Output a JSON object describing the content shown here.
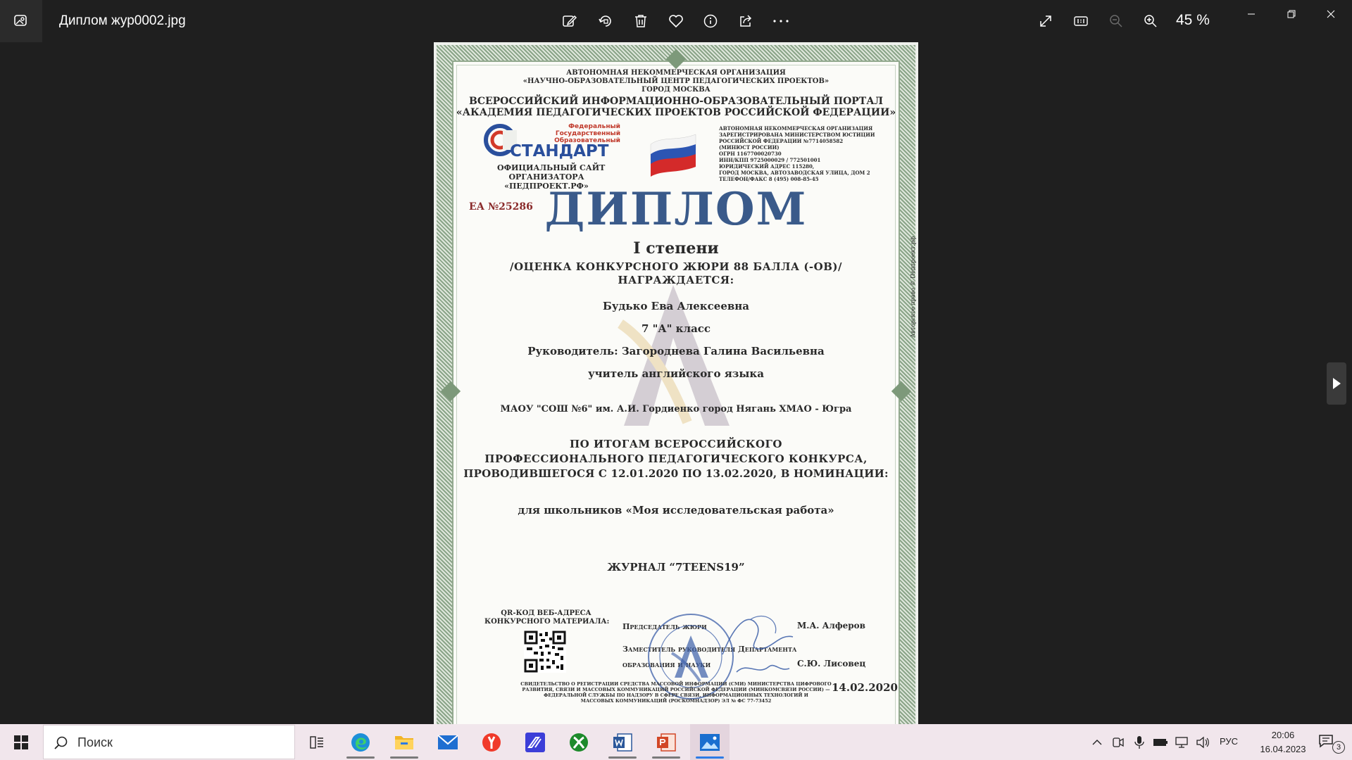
{
  "window": {
    "file_title": "Диплом жур0002.jpg",
    "zoom_label": "45 %"
  },
  "toolbar": {
    "icons": [
      "edit-icon",
      "rotate-icon",
      "delete-icon",
      "favorite-icon",
      "info-icon",
      "share-icon",
      "more-icon"
    ],
    "right_icons": [
      "fullscreen-icon",
      "actual-size-icon",
      "zoom-out-icon",
      "zoom-in-icon"
    ]
  },
  "diploma": {
    "org_line1": "АВТОНОМНАЯ НЕКОММЕРЧЕСКАЯ ОРГАНИЗАЦИЯ",
    "org_line2": "«НАУЧНО-ОБРАЗОВАТЕЛЬНЫЙ ЦЕНТР ПЕДАГОГИЧЕСКИХ ПРОЕКТОВ»",
    "org_line3": "ГОРОД МОСКВА",
    "portal_line1": "ВСЕРОССИЙСКИЙ ИНФОРМАЦИОННО-ОБРАЗОВАТЕЛЬНЫЙ ПОРТАЛ",
    "portal_line2": "«АКАДЕМИЯ ПЕДАГОГИЧЕСКИХ ПРОЕКТОВ РОССИЙСКОЙ ФЕДЕРАЦИИ»",
    "logo_word": "СТАНДАРТ",
    "logo_sub1": "Федеральный",
    "logo_sub2": "Государственный",
    "logo_sub3": "Образовательный",
    "site_line1": "ОФИЦИАЛЬНЫЙ САЙТ",
    "site_line2": "ОРГАНИЗАТОРА",
    "site_line3": "«ПЕДПРОЕКТ.РФ»",
    "reg_lines": [
      "АВТОНОМНАЯ НЕКОММЕРЧЕСКАЯ ОРГАНИЗАЦИЯ",
      "ЗАРЕГИСТРИРОВАНА МИНИСТЕРСТВОМ ЮСТИЦИИ",
      "РОССИЙСКОЙ ФЕДЕРАЦИИ №7714058582",
      "(МИНЮСТ РОССИИ)",
      "ОГРН 1167700020730",
      "ИНН/КПП 9725000029 / 772501001",
      "ЮРИДИЧЕСКИЙ АДРЕС 115280,",
      "ГОРОД МОСКВА, АВТОЗАВОДСКАЯ УЛИЦА, ДОМ 2",
      "ТЕЛЕФОН/ФАКС 8 (495) 008-85-45"
    ],
    "ea_number": "ЕА №25286",
    "title": "ДИПЛОМ",
    "degree": "I степени",
    "score_line": "/ОЦЕНКА КОНКУРСНОГО ЖЮРИ   88    БАЛЛА (-ОВ)/",
    "awarded": "НАГРАЖДАЕТСЯ:",
    "name": "Будько Ева Алексеевна",
    "class": "7 \"А\" класс",
    "supervisor": "Руководитель: Загороднева Галина Васильевна",
    "supervisor_role": "учитель английского языка",
    "school": "МАОУ \"СОШ №6\" им. А.И. Гордиенко город Нягань ХМАО - Югра",
    "result_line1": "ПО ИТОГАМ ВСЕРОССИЙСКОГО",
    "result_line2": "ПРОФЕССИОНАЛЬНОГО ПЕДАГОГИЧЕСКОГО КОНКУРСА,",
    "result_line3": "ПРОВОДИВШЕГОСЯ С 12.01.2020 ПО 13.02.2020, В НОМИНАЦИИ:",
    "nomination": "для школьников «Моя исследовательская работа»",
    "journal": "ЖУРНАЛ “7TEENS19”",
    "qr_line1": "QR-КОД ВЕБ-АДРЕСА",
    "qr_line2": "КОНКУРСНОГО МАТЕРИАЛА:",
    "chair_role": "Председатель жюри",
    "chair_name": "М.А. Алферов",
    "deputy_role1": "Заместитель руководителя Департамента",
    "deputy_role2": "образования и науки",
    "deputy_name": "С.Ю. Лисовец",
    "cert_line1": "СВИДЕТЕЛЬСТВО О РЕГИСТРАЦИИ СРЕДСТВА МАССОВОЙ ИНФОРМАЦИИ (СМИ) МИНИСТЕРСТВА ЦИФРОВОГО",
    "cert_line2": "РАЗВИТИЯ, СВЯЗИ И МАССОВЫХ КОММУНИКАЦИЙ РОССИЙСКОЙ ФЕДЕРАЦИИ (МИНКОМСВЯЗИ РОССИИ) —",
    "cert_line3": "ФЕДЕРАЛЬНОЙ СЛУЖБЫ ПО НАДЗОРУ В СФЕРЕ СВЯЗИ, ИНФОРМАЦИОННЫХ ТЕХНОЛОГИЙ И",
    "cert_line4": "МАССОВЫХ КОММУНИКАЦИЙ (РОСКОМНАДЗОР) ЭЛ № ФС 77-73452",
    "date": "14.02.2020",
    "side_text": "Авторское право © Педпроект.рф"
  },
  "taskbar": {
    "search_placeholder": "Поиск",
    "apps": [
      "task-view-icon",
      "edge-icon",
      "file-explorer-icon",
      "mail-icon",
      "yandex-browser-icon",
      "stylus-app-icon",
      "xbox-icon",
      "word-icon",
      "powerpoint-icon",
      "photos-icon"
    ],
    "language": "РУС",
    "time": "20:06",
    "date": "16.04.2023",
    "notifications": "3"
  },
  "colors": {
    "titlebar_bg": "#1f1f1f",
    "taskbar_bg": "#f1e6ec",
    "diploma_title": "#3a5a8a",
    "ea_number": "#8a2a2a"
  }
}
